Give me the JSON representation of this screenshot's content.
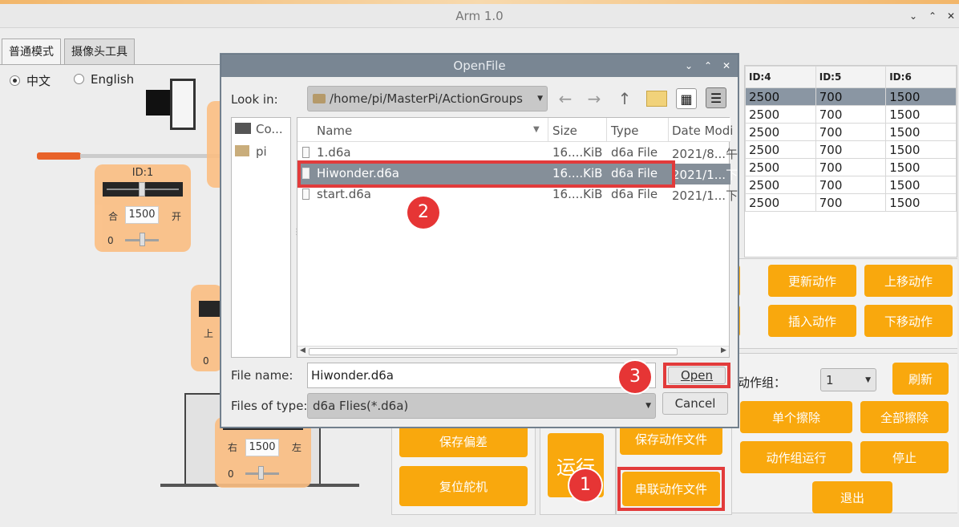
{
  "window": {
    "title": "Arm 1.0"
  },
  "tabs": [
    {
      "label": "普通模式"
    },
    {
      "label": "摄像头工具"
    }
  ],
  "language": {
    "options": [
      {
        "label": "中文",
        "selected": true
      },
      {
        "label": "English",
        "selected": false
      }
    ]
  },
  "servo_panels": [
    {
      "id_label": "ID:1",
      "left_label": "合",
      "value": "1500",
      "right_label": "开",
      "offset": "0"
    },
    {
      "left_label": "上",
      "offset": "0"
    },
    {
      "left_label": "右",
      "value": "1500",
      "right_label": "左",
      "offset": "0"
    }
  ],
  "action_table": {
    "columns": [
      "ID:4",
      "ID:5",
      "ID:6"
    ],
    "rows": [
      [
        "2500",
        "700",
        "1500"
      ],
      [
        "2500",
        "700",
        "1500"
      ],
      [
        "2500",
        "700",
        "1500"
      ],
      [
        "2500",
        "700",
        "1500"
      ],
      [
        "2500",
        "700",
        "1500"
      ],
      [
        "2500",
        "700",
        "1500"
      ],
      [
        "2500",
        "700",
        "1500"
      ]
    ]
  },
  "buttons": {
    "update_action": "更新动作",
    "move_up_action": "上移动作",
    "insert_action": "插入动作",
    "move_down_action": "下移动作",
    "action_group_label": "动作组：",
    "action_group_value": "1",
    "refresh": "刷新",
    "erase_single": "单个擦除",
    "erase_all": "全部擦除",
    "run_group": "动作组运行",
    "stop": "停止",
    "exit": "退出",
    "save_offset": "保存偏差",
    "reset_servo": "复位舵机",
    "run": "运行",
    "save_action_file": "保存动作文件",
    "chain_action_file": "串联动作文件"
  },
  "dialog": {
    "title": "OpenFile",
    "look_in_label": "Look in:",
    "path": "/home/pi/MasterPi/ActionGroups",
    "sidebar": [
      {
        "label": "Co..."
      },
      {
        "label": "pi"
      }
    ],
    "columns": [
      "Name",
      "Size",
      "Type",
      "Date Modi"
    ],
    "files": [
      {
        "name": "1.d6a",
        "size": "16....KiB",
        "type": "d6a File",
        "date": "2021/8...午"
      },
      {
        "name": "Hiwonder.d6a",
        "size": "16....KiB",
        "type": "d6a File",
        "date": "2021/1...下"
      },
      {
        "name": "start.d6a",
        "size": "16....KiB",
        "type": "d6a File",
        "date": "2021/1...下"
      }
    ],
    "file_name_label": "File name:",
    "file_name_value": "Hiwonder.d6a",
    "files_of_type_label": "Files of type:",
    "files_of_type_value": "d6a Flies(*.d6a)",
    "open_button": "Open",
    "cancel_button": "Cancel"
  },
  "annotations": [
    "1",
    "2",
    "3"
  ],
  "colors": {
    "accent": "#f9a80d",
    "panel": "#fbbe82",
    "highlight": "#e23b3b",
    "dialog_title": "#798693"
  }
}
